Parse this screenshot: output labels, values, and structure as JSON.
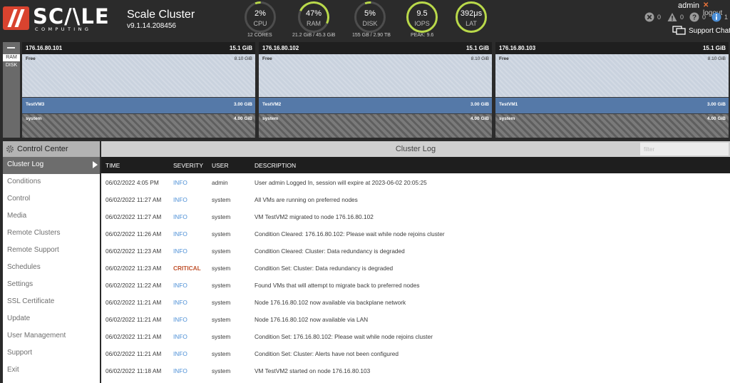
{
  "header": {
    "logo_word": "SC/\\LE",
    "logo_sub": "COMPUTING",
    "cluster_title": "Scale Cluster",
    "cluster_version": "v9.1.14.208456",
    "user": "admin",
    "logout_label": "logout",
    "alerts": {
      "errors": "0",
      "warnings": "0",
      "unknown": "0",
      "info": "1"
    },
    "support_chat": "Support Chat"
  },
  "gauges": {
    "cpu": {
      "value": "2%",
      "label": "CPU",
      "caption": "12 CORES",
      "fraction": 0.02
    },
    "ram": {
      "value": "47%",
      "label": "RAM",
      "caption": "21.2 GiB / 45.3 GiB",
      "fraction": 0.47
    },
    "disk": {
      "value": "5%",
      "label": "DISK",
      "caption": "155 GB / 2.90 TB",
      "fraction": 0.05
    },
    "iops": {
      "value": "9.5",
      "label": "IOPS",
      "caption": "PEAK: 9.6"
    },
    "lat": {
      "value": "392μs",
      "label": "LAT"
    }
  },
  "view_toggle": {
    "ram": "RAM",
    "disk": "DISK",
    "selected": "RAM"
  },
  "nodes": [
    {
      "ip": "176.16.80.101",
      "total": "15.1 GiB",
      "free": {
        "name": "Free",
        "size": "8.10 GiB"
      },
      "vm": {
        "name": "TestVM3",
        "size": "3.00 GiB"
      },
      "system": {
        "name": "system",
        "size": "4.00 GiB"
      }
    },
    {
      "ip": "176.16.80.102",
      "total": "15.1 GiB",
      "free": {
        "name": "Free",
        "size": "8.10 GiB"
      },
      "vm": {
        "name": "TestVM2",
        "size": "3.00 GiB"
      },
      "system": {
        "name": "system",
        "size": "4.00 GiB"
      }
    },
    {
      "ip": "176.16.80.103",
      "total": "15.1 GiB",
      "free": {
        "name": "Free",
        "size": "8.10 GiB"
      },
      "vm": {
        "name": "TestVM1",
        "size": "3.00 GiB"
      },
      "system": {
        "name": "system",
        "size": "4.00 GiB"
      }
    }
  ],
  "control_center": {
    "title": "Control Center",
    "items": [
      "Cluster Log",
      "Conditions",
      "Control",
      "Media",
      "Remote Clusters",
      "Remote Support",
      "Schedules",
      "Settings",
      "SSL Certificate",
      "Update",
      "User Management",
      "Support",
      "Exit"
    ],
    "active": "Cluster Log"
  },
  "cluster_log": {
    "title": "Cluster Log",
    "filter_placeholder": "filter",
    "columns": {
      "time": "TIME",
      "severity": "SEVERITY",
      "user": "USER",
      "description": "DESCRIPTION"
    },
    "rows": [
      {
        "time": "06/02/2022 4:05 PM",
        "severity": "INFO",
        "user": "admin",
        "description": "User admin Logged In, session will expire at 2023-06-02 20:05:25"
      },
      {
        "time": "06/02/2022 11:27 AM",
        "severity": "INFO",
        "user": "system",
        "description": "All VMs are running on preferred nodes"
      },
      {
        "time": "06/02/2022 11:27 AM",
        "severity": "INFO",
        "user": "system",
        "description": "VM TestVM2 migrated to node 176.16.80.102"
      },
      {
        "time": "06/02/2022 11:26 AM",
        "severity": "INFO",
        "user": "system",
        "description": "Condition Cleared: 176.16.80.102: Please wait while node rejoins cluster"
      },
      {
        "time": "06/02/2022 11:23 AM",
        "severity": "INFO",
        "user": "system",
        "description": "Condition Cleared: Cluster: Data redundancy is degraded"
      },
      {
        "time": "06/02/2022 11:23 AM",
        "severity": "CRITICAL",
        "user": "system",
        "description": "Condition Set: Cluster: Data redundancy is degraded"
      },
      {
        "time": "06/02/2022 11:22 AM",
        "severity": "INFO",
        "user": "system",
        "description": "Found VMs that will attempt to migrate back to preferred nodes"
      },
      {
        "time": "06/02/2022 11:21 AM",
        "severity": "INFO",
        "user": "system",
        "description": "Node 176.16.80.102 now available via backplane network"
      },
      {
        "time": "06/02/2022 11:21 AM",
        "severity": "INFO",
        "user": "system",
        "description": "Node 176.16.80.102 now available via LAN"
      },
      {
        "time": "06/02/2022 11:21 AM",
        "severity": "INFO",
        "user": "system",
        "description": "Condition Set: 176.16.80.102: Please wait while node rejoins cluster"
      },
      {
        "time": "06/02/2022 11:21 AM",
        "severity": "INFO",
        "user": "system",
        "description": "Condition Set: Cluster: Alerts have not been configured"
      },
      {
        "time": "06/02/2022 11:18 AM",
        "severity": "INFO",
        "user": "system",
        "description": "VM TestVM2 started on node 176.16.80.103"
      }
    ]
  },
  "colors": {
    "brand": "#d9432f",
    "gauge_accent": "#b9d94a",
    "info": "#4c8fd6",
    "critical": "#c0522d",
    "vm_segment": "#5579a8"
  },
  "icons": {
    "logo": "scale-logo-icon",
    "error": "x-circle-icon",
    "warning": "warning-triangle-icon",
    "unknown": "question-circle-icon",
    "info": "info-circle-icon",
    "chat": "chat-icon",
    "gear": "gear-icon",
    "arrow": "triangle-right-icon"
  }
}
